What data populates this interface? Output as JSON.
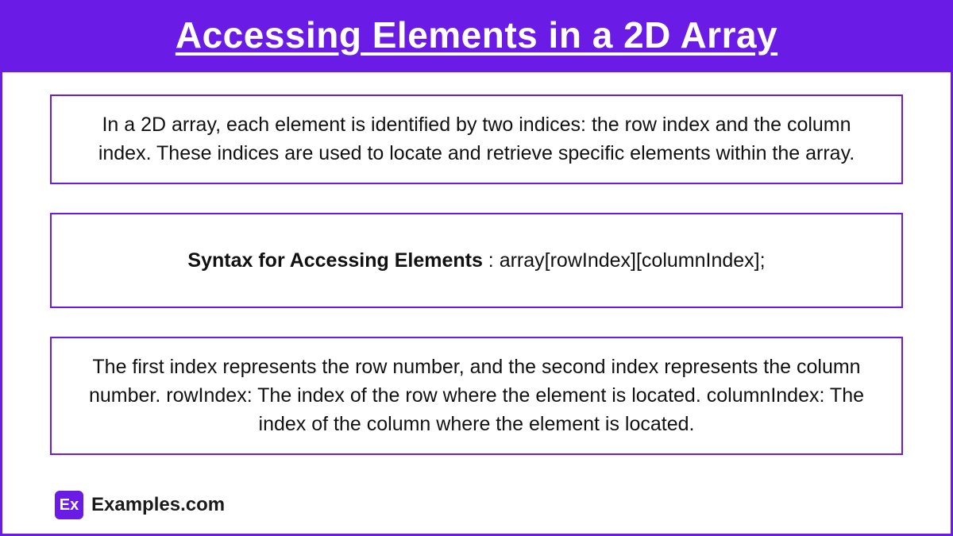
{
  "header": {
    "title": "Accessing Elements in a 2D Array"
  },
  "boxes": {
    "intro": "In a 2D array, each element is identified by two indices: the row index and the column index. These indices are used to locate and retrieve specific elements within the array.",
    "syntax_label": "Syntax for Accessing Elements",
    "syntax_code": " :  array[rowIndex][columnIndex];",
    "detail": "The first index represents the row number, and the second index represents the column number.  rowIndex: The index of the row where the element is located. columnIndex: The index of the column where the element is located."
  },
  "footer": {
    "logo_text": "Ex",
    "brand": "Examples.com"
  },
  "colors": {
    "accent": "#6a1be6"
  }
}
